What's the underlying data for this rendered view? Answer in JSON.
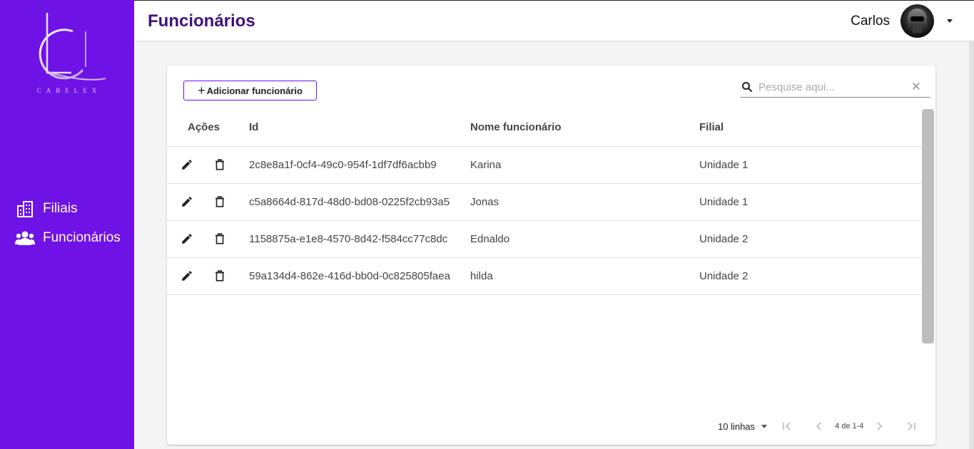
{
  "sidebar": {
    "logo_text": "CABELEX",
    "items": [
      {
        "label": "Filiais",
        "icon": "building-icon"
      },
      {
        "label": "Funcionários",
        "icon": "people-icon"
      }
    ]
  },
  "header": {
    "title": "Funcionários",
    "user_name": "Carlos"
  },
  "toolbar": {
    "add_label": "Adicionar funcionário",
    "search_placeholder": "Pesquise aqui..."
  },
  "table": {
    "columns": [
      "Ações",
      "Id",
      "Nome funcionário",
      "Filial"
    ],
    "rows": [
      {
        "id": "2c8e8a1f-0cf4-49c0-954f-1df7df6acbb9",
        "name": "Karina",
        "filial": "Unidade 1"
      },
      {
        "id": "c5a8664d-817d-48d0-bd08-0225f2cb93a5",
        "name": "Jonas",
        "filial": "Unidade 1"
      },
      {
        "id": "1158875a-e1e8-4570-8d42-f584cc77c8dc",
        "name": "Ednaldo",
        "filial": "Unidade 2"
      },
      {
        "id": "59a134d4-862e-416d-bb0d-0c825805faea",
        "name": "hilda",
        "filial": "Unidade 2"
      }
    ]
  },
  "pagination": {
    "rows_per_page": "10 linhas",
    "info": "4 de 1-4"
  },
  "colors": {
    "sidebar": "#6f12e6",
    "title": "#3d1278",
    "accent": "#6f12e6"
  }
}
